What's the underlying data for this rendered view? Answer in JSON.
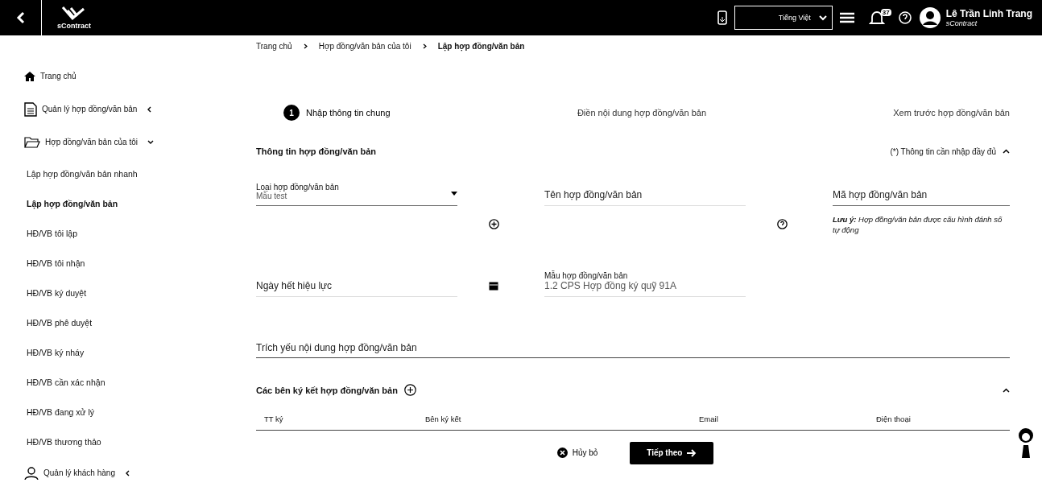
{
  "header": {
    "brand": "sContract",
    "language": "Tiếng Việt",
    "notification_count": "37",
    "user_name": "Lê Trần Linh Trang",
    "user_org": "sContract"
  },
  "sidebar": {
    "items": [
      {
        "kind": "top",
        "label": "Trang chủ"
      },
      {
        "kind": "group",
        "label": "Quản lý hợp đồng/văn bản",
        "expanded": false
      },
      {
        "kind": "group",
        "label": "Hợp đồng/văn bản của tôi",
        "expanded": true
      },
      {
        "kind": "sub",
        "label": "Lập hợp đồng/văn bản nhanh",
        "selected": false
      },
      {
        "kind": "sub",
        "label": "Lập hợp đồng/văn bản",
        "selected": true
      },
      {
        "kind": "sub",
        "label": "HĐ/VB tôi lập",
        "selected": false
      },
      {
        "kind": "sub",
        "label": "HĐ/VB tôi nhận",
        "selected": false
      },
      {
        "kind": "sub",
        "label": "HĐ/VB ký duyệt",
        "selected": false
      },
      {
        "kind": "sub",
        "label": "HĐ/VB phê duyệt",
        "selected": false
      },
      {
        "kind": "sub",
        "label": "HĐ/VB ký nháy",
        "selected": false
      },
      {
        "kind": "sub",
        "label": "HĐ/VB cần xác nhận",
        "selected": false
      },
      {
        "kind": "sub",
        "label": "HĐ/VB đang xử lý",
        "selected": false
      },
      {
        "kind": "sub",
        "label": "HĐ/VB thương thảo",
        "selected": false
      },
      {
        "kind": "group",
        "label": "Quản lý khách hàng",
        "expanded": false
      }
    ]
  },
  "breadcrumb": [
    "Trang chủ",
    "Hợp đồng/văn bản của tôi",
    "Lập hợp đồng/văn bản"
  ],
  "steps": [
    {
      "number": "1",
      "label": "Nhập thông tin chung",
      "selected": true
    },
    {
      "label": "Điền nội dung hợp đồng/văn bản",
      "selected": false
    },
    {
      "label": "Xem trước hợp đồng/văn bản",
      "selected": false
    }
  ],
  "section": {
    "title": "Thông tin hợp đồng/văn bản",
    "required_note": "(*) Thông tin cần nhập đầy đủ",
    "expanded": true
  },
  "fields": {
    "type": {
      "label": "Loại hợp đồng/văn bản",
      "value": "Mẫu test"
    },
    "name": {
      "placeholder": "Tên hợp đồng/văn bản"
    },
    "code": {
      "placeholder": "Mã hợp đồng/văn bản",
      "note": "**Lưu ý:** Hợp đồng/văn bản được cấu hình đánh số tự động"
    },
    "expiry": {
      "placeholder": "Ngày hết hiệu lực"
    },
    "template": {
      "label": "Mẫu hợp đồng/văn bản",
      "value": "1.2 CPS Hợp đồng ký quỹ 91A"
    },
    "summary": {
      "placeholder": "Trích yếu nội dung hợp đồng/văn bản"
    }
  },
  "parties": {
    "title": "Các bên ký kết hợp đồng/văn bản",
    "expanded": true,
    "columns": [
      "TT ký",
      "Bên ký kết",
      "Email",
      "Điện thoại"
    ]
  },
  "buttons": {
    "cancel": "Hủy bỏ",
    "next": "Tiếp theo"
  }
}
